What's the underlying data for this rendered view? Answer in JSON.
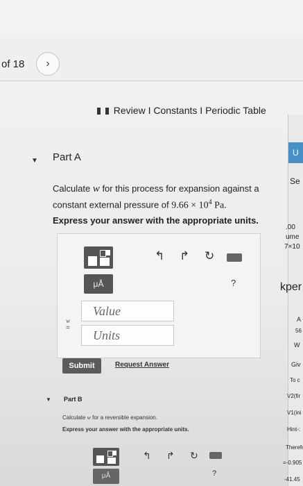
{
  "pager": {
    "text": "of 18",
    "next_icon": "chevron-right-icon",
    "next_glyph": "›"
  },
  "links": {
    "review": "Review",
    "constants": "Constants",
    "periodic": "Periodic Table",
    "sep": "I"
  },
  "partA": {
    "title": "Part A",
    "q_pre": "Calculate ",
    "q_var": "w",
    "q_mid": " for this process for expansion against a",
    "q_line2_pre": "constant external pressure of ",
    "q_value": "9.66 × 10",
    "q_exp": "4",
    "q_unit": " Pa.",
    "instruction": "Express your answer with the appropriate units.",
    "answer_var": "w",
    "answer_eq": "=",
    "value_placeholder": "Value",
    "units_placeholder": "Units",
    "mu_label": "μÅ",
    "help": "?",
    "submit": "Submit",
    "request": "Request Answer"
  },
  "partB": {
    "title": "Part B",
    "q_pre": "Calculate ",
    "q_var": "w",
    "q_post": " for a reversible expansion.",
    "instruction": "Express your answer with the appropriate units.",
    "mu_label": "μÅ",
    "help": "?"
  },
  "right_strip": {
    "top_letter": "U",
    "se": "Se",
    "oo": ".00",
    "ume": "ume",
    "x10": "7×10",
    "per": "kper",
    "a": "A",
    "five": "56",
    "w": "W",
    "giv": "Giv",
    "toc": "To c",
    "v2": "V2(fir",
    "v1": "V1(ini",
    "hint": "Hint-:",
    "therefore": "Therefc",
    "neg": "=-0.905",
    "last": "-41.45"
  }
}
